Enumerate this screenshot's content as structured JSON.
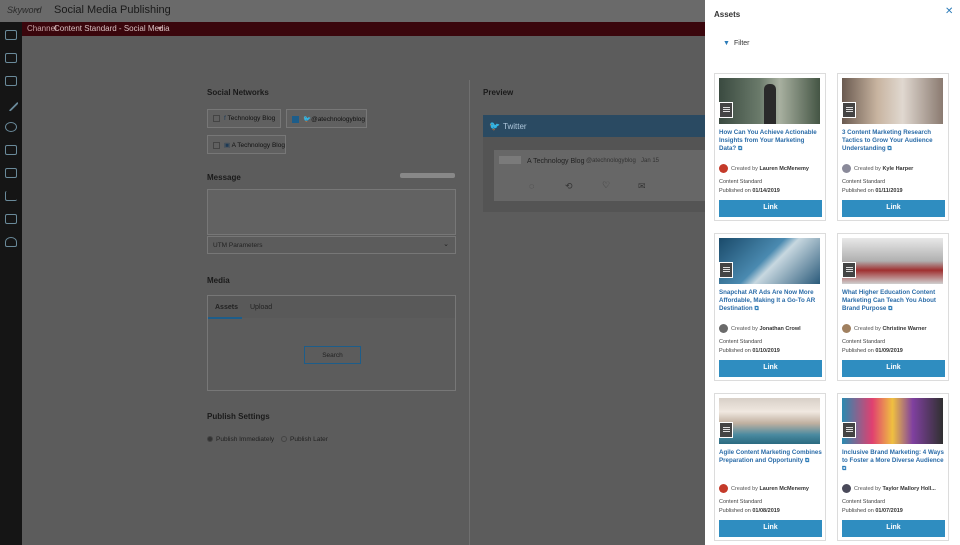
{
  "header": {
    "logo": "Skyword",
    "app_title": "Social Media Publishing"
  },
  "channel_bar": {
    "label": "Channel",
    "value": "Content Standard - Social Media"
  },
  "social_networks": {
    "heading": "Social Networks",
    "accounts": [
      {
        "label": "Technology Blog",
        "icon": "facebook-icon",
        "checked": false
      },
      {
        "label": "@atechnologyblog",
        "icon": "twitter-icon",
        "checked": true
      },
      {
        "label": "A Technology Blog",
        "icon": "linkedin-icon",
        "checked": false
      }
    ]
  },
  "message": {
    "heading": "Message",
    "utm_label": "UTM Parameters"
  },
  "media": {
    "heading": "Media",
    "tabs": [
      "Assets",
      "Upload"
    ],
    "search_label": "Search"
  },
  "publish": {
    "heading": "Publish Settings",
    "options": [
      "Publish Immediately",
      "Publish Later"
    ]
  },
  "preview": {
    "heading": "Preview",
    "network": "Twitter",
    "account_name": "A Technology Blog",
    "handle": "@atechnologyblog",
    "date": "Jan 15"
  },
  "assets_panel": {
    "title": "Assets",
    "filter_label": "Filter",
    "cards": [
      {
        "title": "How Can You Achieve Actionable Insights from Your Marketing Data?",
        "created_by_label": "Created by",
        "author": "Lauren McMenemy",
        "source": "Content Standard",
        "published_label": "Published on",
        "date": "01/14/2019",
        "link_label": "Link"
      },
      {
        "title": "3 Content Marketing Research Tactics to Grow Your Audience Understanding",
        "created_by_label": "Created by",
        "author": "Kyle Harper",
        "source": "Content Standard",
        "published_label": "Published on",
        "date": "01/11/2019",
        "link_label": "Link"
      },
      {
        "title": "Snapchat AR Ads Are Now More Affordable, Making It a Go-To AR Destination",
        "created_by_label": "Created by",
        "author": "Jonathan Crowl",
        "source": "Content Standard",
        "published_label": "Published on",
        "date": "01/10/2019",
        "link_label": "Link"
      },
      {
        "title": "What Higher Education Content Marketing Can Teach You About Brand Purpose",
        "created_by_label": "Created by",
        "author": "Christine Warner",
        "source": "Content Standard",
        "published_label": "Published on",
        "date": "01/09/2019",
        "link_label": "Link"
      },
      {
        "title": "Agile Content Marketing Combines Preparation and Opportunity",
        "created_by_label": "Created by",
        "author": "Lauren McMenemy",
        "source": "Content Standard",
        "published_label": "Published on",
        "date": "01/08/2019",
        "link_label": "Link"
      },
      {
        "title": "Inclusive Brand Marketing: 4 Ways to Foster a More Diverse Audience",
        "created_by_label": "Created by",
        "author": "Taylor Mallory Holl...",
        "source": "Content Standard",
        "published_label": "Published on",
        "date": "01/07/2019",
        "link_label": "Link"
      }
    ]
  }
}
